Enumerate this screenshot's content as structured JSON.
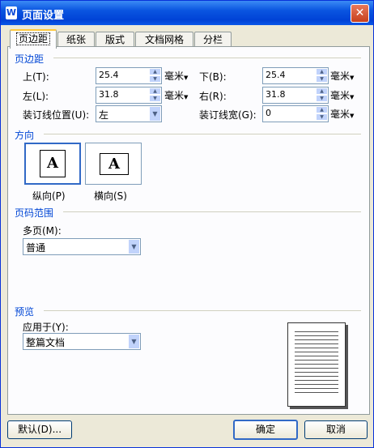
{
  "title": "页面设置",
  "tabs": [
    "页边距",
    "纸张",
    "版式",
    "文档网格",
    "分栏"
  ],
  "margins": {
    "group_title": "页边距",
    "top_label": "上(T):",
    "top_value": "25.4",
    "bottom_label": "下(B):",
    "bottom_value": "25.4",
    "left_label": "左(L):",
    "left_value": "31.8",
    "right_label": "右(R):",
    "right_value": "31.8",
    "gutter_pos_label": "装订线位置(U):",
    "gutter_pos_value": "左",
    "gutter_width_label": "装订线宽(G):",
    "gutter_width_value": "0",
    "unit": "毫米"
  },
  "orientation": {
    "group_title": "方向",
    "portrait_label": "纵向(P)",
    "landscape_label": "横向(S)",
    "glyph": "A",
    "selected": "portrait"
  },
  "pages": {
    "group_title": "页码范围",
    "multiple_label": "多页(M):",
    "multiple_value": "普通"
  },
  "preview": {
    "group_title": "预览",
    "apply_label": "应用于(Y):",
    "apply_value": "整篇文档"
  },
  "buttons": {
    "default": "默认(D)...",
    "ok": "确定",
    "cancel": "取消"
  }
}
